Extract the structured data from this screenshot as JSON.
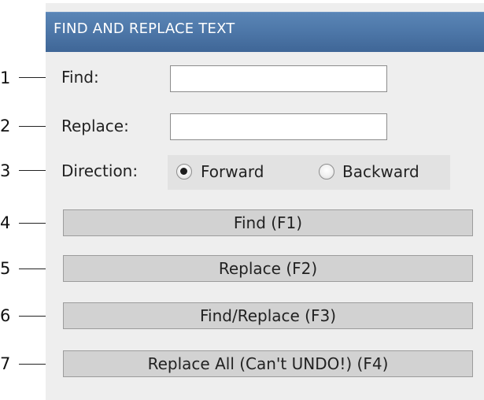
{
  "dialog": {
    "title": "FIND AND REPLACE TEXT"
  },
  "callouts": [
    "1",
    "2",
    "3",
    "4",
    "5",
    "6",
    "7"
  ],
  "find": {
    "label": "Find:",
    "value": ""
  },
  "replace": {
    "label": "Replace:",
    "value": ""
  },
  "direction": {
    "label": "Direction:",
    "options": [
      "Forward",
      "Backward"
    ],
    "selected": "Forward"
  },
  "buttons": {
    "find": "Find (F1)",
    "replace": "Replace (F2)",
    "find_replace": "Find/Replace (F3)",
    "replace_all": "Replace All (Can't UNDO!) (F4)"
  },
  "colors": {
    "title_bar": "#4e78a9",
    "panel": "#eeeeee",
    "button": "#d2d2d2"
  }
}
